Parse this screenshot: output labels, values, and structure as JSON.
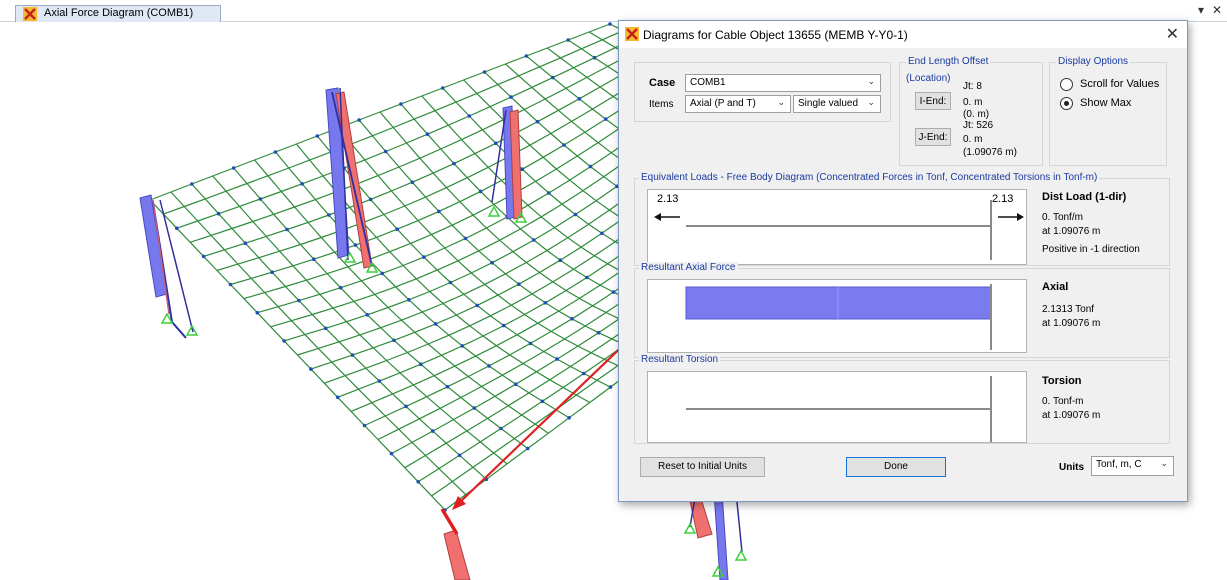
{
  "document_tab": {
    "title": "Axial Force Diagram (COMB1)"
  },
  "strip_controls": {
    "menu": "▾",
    "close": "✕"
  },
  "dialog": {
    "title": "Diagrams for Cable Object 13655  (MEMB Y-Y0-1)",
    "close_glyph": "✕",
    "case_label": "Case",
    "case_value": "COMB1",
    "items_label": "Items",
    "items_value": "Axial (P and T)",
    "items_mode": "Single valued",
    "end_offset": {
      "title": "End Length Offset",
      "location": "(Location)",
      "jt_i": "Jt:  8",
      "i_end_button": "I-End:",
      "i_value": "0. m",
      "i_location": "(0. m)",
      "jt_j": "Jt:  526",
      "j_end_button": "J-End:",
      "j_value": "0. m",
      "j_location": "(1.09076 m)"
    },
    "display_options": {
      "title": "Display Options",
      "scroll": "Scroll for Values",
      "show_max": "Show Max",
      "selected": "show_max"
    },
    "equivalent_loads": {
      "title": "Equivalent Loads - Free Body Diagram  (Concentrated Forces in Tonf, Concentrated Torsions in Tonf-m)",
      "left_value": "2.13",
      "right_value": "2.13",
      "side_title": "Dist Load (1-dir)",
      "line1": "0. Tonf/m",
      "line2": "at 1.09076 m",
      "line3": "Positive in -1 direction"
    },
    "axial": {
      "title": "Resultant Axial Force",
      "side_title": "Axial",
      "line1": "2.1313 Tonf",
      "line2": "at 1.09076 m",
      "bar_color": "#7b7bf0"
    },
    "torsion": {
      "title": "Resultant Torsion",
      "side_title": "Torsion",
      "line1": "0. Tonf-m",
      "line2": "at 1.09076 m"
    },
    "reset_button": "Reset to Initial Units",
    "done_button": "Done",
    "units_label": "Units",
    "units_value": "Tonf, m, C"
  },
  "colors": {
    "mesh": "#2e8b3a",
    "node": "#1f4fb5",
    "member": "#6e6ef0",
    "member_pink": "#f08080",
    "arrow": "#e02020",
    "support": "#3cd03c"
  }
}
